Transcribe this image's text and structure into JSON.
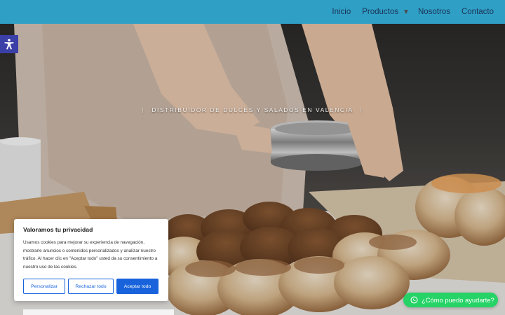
{
  "nav": {
    "items": [
      {
        "label": "Inicio"
      },
      {
        "label": "Productos",
        "has_dropdown": true
      },
      {
        "label": "Nosotros"
      },
      {
        "label": "Contacto"
      }
    ],
    "background": "#2f9fc6",
    "text_color": "#1c3556"
  },
  "hero": {
    "tagline": "DISTRIBUIDOR DE DULCES Y SALADOS EN VALENCIA",
    "separator": "|"
  },
  "accessibility": {
    "icon": "accessibility-icon",
    "color": "#3b3fa8"
  },
  "cookie": {
    "title": "Valoramos tu privacidad",
    "body": "Usamos cookies para mejorar su experiencia de navegación, mostrarle anuncios o contenidos personalizados y analizar nuestro tráfico. Al hacer clic en \"Aceptar todo\" usted da su consentimiento a nuestro uso de las cookies.",
    "customize_label": "Personalizar",
    "reject_label": "Rechazar todo",
    "accept_label": "Aceptar todo",
    "accent": "#1863dc"
  },
  "chat": {
    "label": "¿Cómo puedo ayudarte?",
    "icon": "whatsapp-icon",
    "color": "#25d366"
  }
}
